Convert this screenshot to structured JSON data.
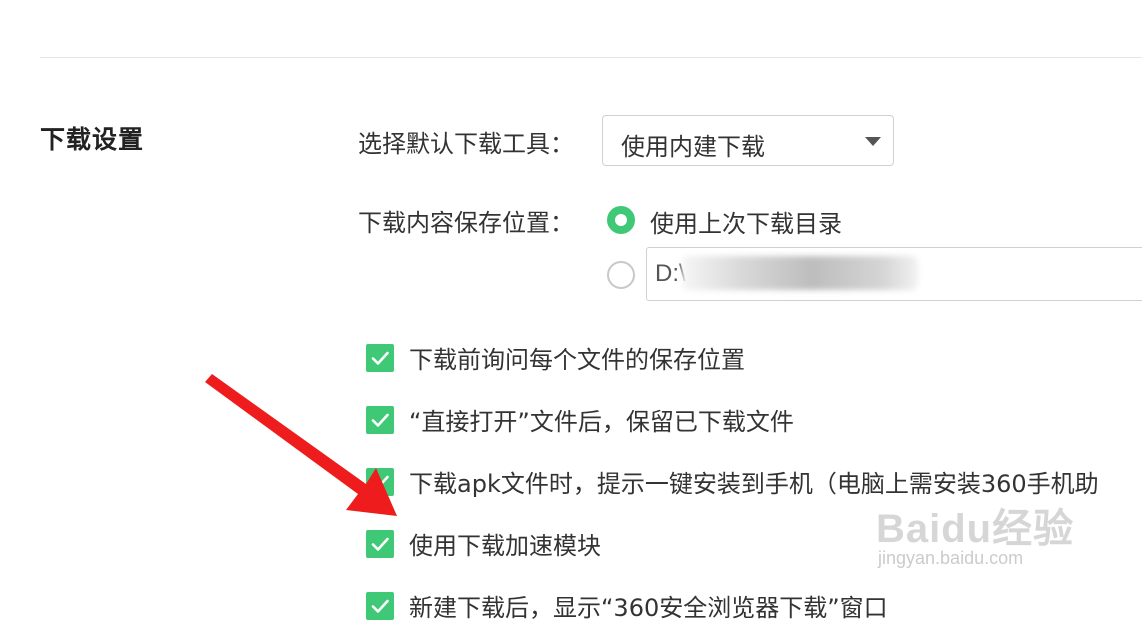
{
  "section": {
    "title": "下载设置"
  },
  "default_tool": {
    "label": "选择默认下载工具：",
    "selected": "使用内建下载"
  },
  "save_location": {
    "label": "下载内容保存位置：",
    "options": [
      {
        "label": "使用上次下载目录",
        "selected": true
      },
      {
        "value": "D:\\",
        "selected": false
      }
    ]
  },
  "checkboxes": [
    {
      "label": "下载前询问每个文件的保存位置",
      "checked": true
    },
    {
      "label": "“直接打开”文件后，保留已下载文件",
      "checked": true
    },
    {
      "label": "下载apk文件时，提示一键安装到手机（电脑上需安装360手机助",
      "checked": true
    },
    {
      "label": "使用下载加速模块",
      "checked": true
    },
    {
      "label": "新建下载后，显示“360安全浏览器下载”窗口",
      "checked": true
    }
  ],
  "watermark": {
    "logo": "Baidu经验",
    "url": "jingyan.baidu.com"
  },
  "colors": {
    "accent": "#3fc876",
    "annotation_arrow": "#ee1c1c"
  },
  "icons": {
    "dropdown": "chevron-down-icon",
    "check": "checkmark-icon",
    "annotation": "red-arrow-icon"
  }
}
